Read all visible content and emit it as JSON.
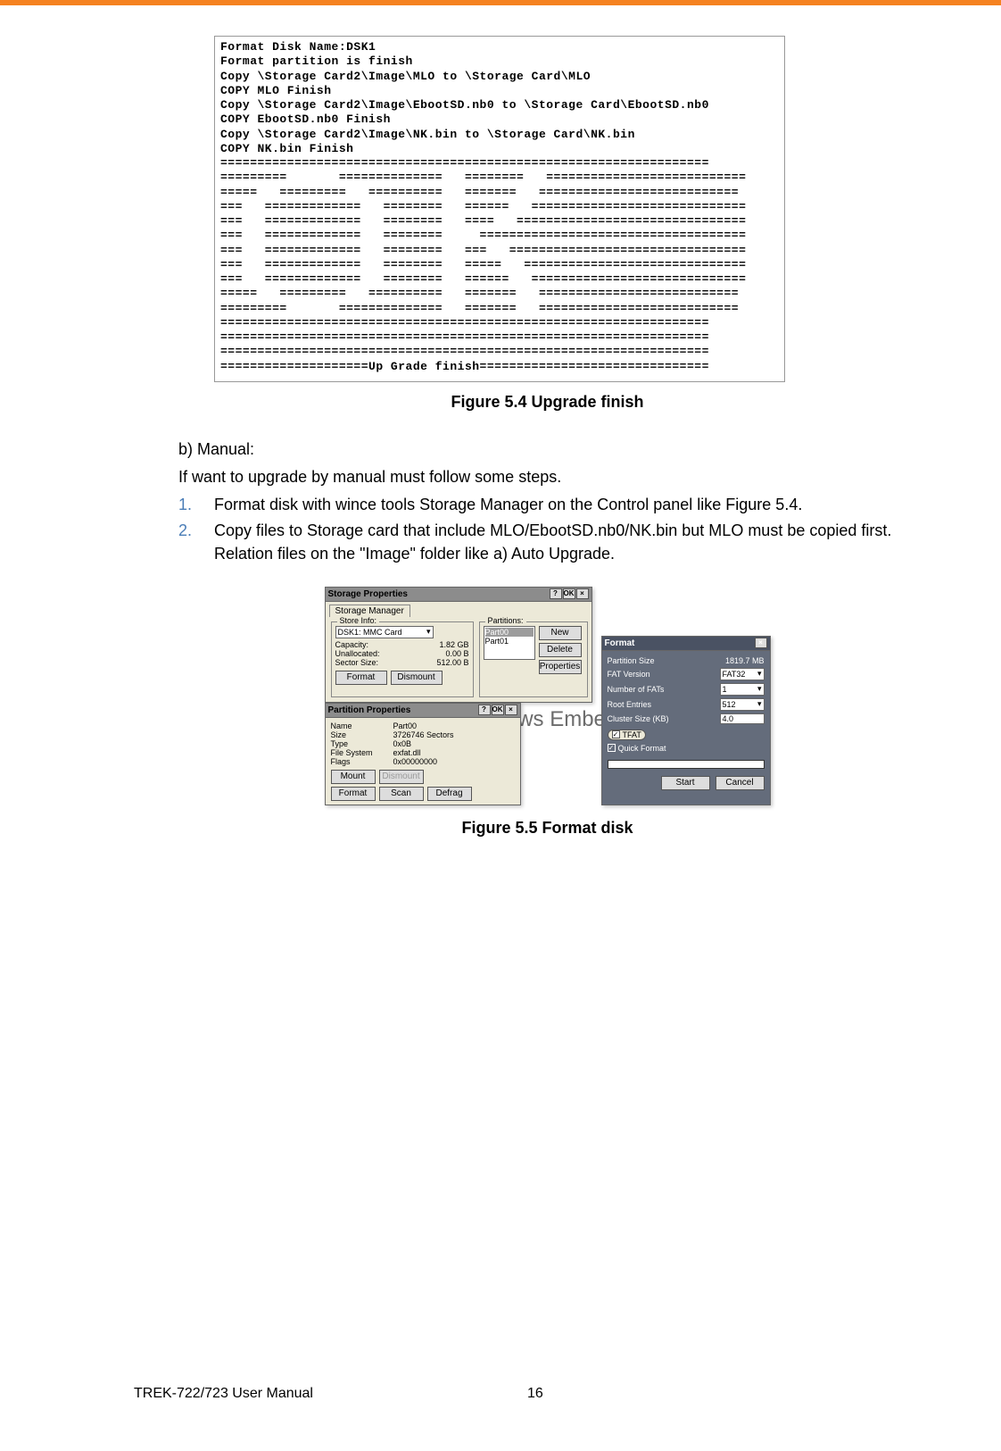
{
  "terminal": {
    "lines": [
      "Format Disk Name:DSK1",
      "Format partition is finish",
      "Copy \\Storage Card2\\Image\\MLO to \\Storage Card\\MLO",
      "COPY MLO Finish",
      "Copy \\Storage Card2\\Image\\EbootSD.nb0 to \\Storage Card\\EbootSD.nb0",
      "COPY EbootSD.nb0 Finish",
      "Copy \\Storage Card2\\Image\\NK.bin to \\Storage Card\\NK.bin",
      "COPY NK.bin Finish",
      "==================================================================",
      "=========       ==============   ========   ===========================",
      "=====   =========   ==========   =======   ===========================",
      "===   =============   ========   ======   =============================",
      "===   =============   ========   ====   ===============================",
      "===   =============   ========     ====================================",
      "===   =============   ========   ===   ================================",
      "===   =============   ========   =====   ==============================",
      "===   =============   ========   ======   =============================",
      "=====   =========   ==========   =======   ===========================",
      "=========       ==============   =======   ===========================",
      "==================================================================",
      "==================================================================",
      "==================================================================",
      "====================Up Grade finish==============================="
    ]
  },
  "captions": {
    "fig54": "Figure 5.4 Upgrade finish",
    "fig55": "Figure 5.5 Format disk"
  },
  "body": {
    "manual_heading": "b) Manual:",
    "manual_intro": "If want to upgrade by manual must follow some steps.",
    "steps": [
      {
        "num": "1.",
        "text": "Format disk with wince tools Storage Manager on the Control panel like Figure 5.4."
      },
      {
        "num": "2.",
        "text": "Copy files to Storage card that include MLO/EbootSD.nb0/NK.bin but MLO must be copied first. Relation files on the \"Image\" folder like a) Auto Upgrade."
      }
    ]
  },
  "storage": {
    "main_title": "Storage Properties",
    "tab": "Storage Manager",
    "store_info": {
      "group_label": "Store Info:",
      "device": "DSK1: MMC Card",
      "rows": [
        {
          "label": "Capacity:",
          "value": "1.82 GB"
        },
        {
          "label": "Unallocated:",
          "value": "0.00 B"
        },
        {
          "label": "Sector Size:",
          "value": "512.00 B"
        }
      ],
      "format_btn": "Format",
      "dismount_btn": "Dismount"
    },
    "partitions": {
      "group_label": "Partitions:",
      "items": [
        "Part00",
        "Part01"
      ],
      "new_btn": "New",
      "delete_btn": "Delete",
      "properties_btn": "Properties"
    },
    "part_props": {
      "title": "Partition Properties",
      "rows": [
        {
          "label": "Name",
          "value": "Part00"
        },
        {
          "label": "Size",
          "value": "3726746 Sectors"
        },
        {
          "label": "Type",
          "value": "0x0B"
        },
        {
          "label": "File System",
          "value": "exfat.dll"
        },
        {
          "label": "Flags",
          "value": "0x00000000"
        }
      ],
      "mount_btn": "Mount",
      "dismount_btn": "Dismount",
      "format_btn": "Format",
      "scan_btn": "Scan",
      "defrag_btn": "Defrag"
    },
    "format": {
      "title": "Format",
      "rows": [
        {
          "label": "Partition Size",
          "value": "1819.7 MB"
        },
        {
          "label": "FAT Version",
          "value": "FAT32"
        },
        {
          "label": "Number of FATs",
          "value": "1"
        },
        {
          "label": "Root Entries",
          "value": "512"
        },
        {
          "label": "Cluster Size (KB)",
          "value": "4.0"
        }
      ],
      "tfat": "TFAT",
      "quick": "Quick Format",
      "start_btn": "Start",
      "cancel_btn": "Cancel"
    },
    "watermark": "dows Embec",
    "help": "?",
    "ok": "OK",
    "close": "×"
  },
  "footer": {
    "manual": "TREK-722/723 User Manual",
    "page": "16"
  }
}
